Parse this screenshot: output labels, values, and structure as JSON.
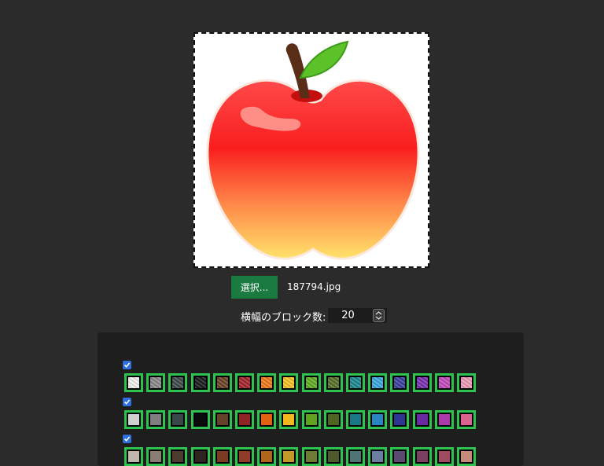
{
  "upload": {
    "select_label": "選択...",
    "filename": "187794.jpg"
  },
  "blocks": {
    "label": "横幅のブロック数:",
    "value": "20"
  },
  "palettes": [
    {
      "checked": true,
      "texture": "wool",
      "colors": [
        "#f2f2f2",
        "#8a8a8a",
        "#3d4a4a",
        "#1a1a1a",
        "#6b4226",
        "#a2222a",
        "#f07a1a",
        "#f9c425",
        "#5fae1f",
        "#566f27",
        "#178a8f",
        "#3aa7de",
        "#3a3fa0",
        "#7a2fb0",
        "#c44bbf",
        "#ee9bb7"
      ]
    },
    {
      "checked": true,
      "texture": "solid",
      "colors": [
        "#d0d0d0",
        "#7e7e7e",
        "#37474a",
        "#0b0b0b",
        "#64432a",
        "#8e2424",
        "#e06110",
        "#f2b81d",
        "#5fa31f",
        "#4d6520",
        "#1a7886",
        "#2a86c3",
        "#2e3693",
        "#6a2aa0",
        "#ad3aab",
        "#d8648f"
      ]
    },
    {
      "checked": true,
      "texture": "solid",
      "colors": [
        "#bfb6ad",
        "#8a7d74",
        "#4d3b2f",
        "#2f2520",
        "#7a3d22",
        "#8f3b2a",
        "#b0661c",
        "#c29a2a",
        "#6e7b32",
        "#4e5a2c",
        "#4e7476",
        "#6b7da0",
        "#5a4a70",
        "#7b3f61",
        "#a04b5f",
        "#c58a7c"
      ]
    }
  ]
}
